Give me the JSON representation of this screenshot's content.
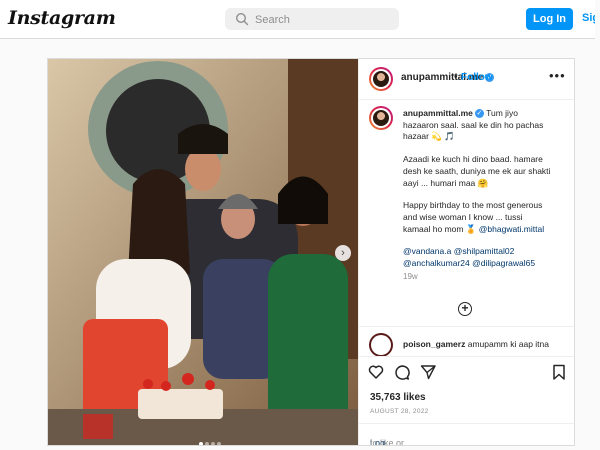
{
  "nav": {
    "logo": "Instagram",
    "search_placeholder": "Search",
    "login_label": "Log In",
    "signup_label": "Sign Up"
  },
  "post": {
    "username": "anupammittal.me",
    "follow_separator": "•",
    "follow_label": "Follow",
    "more_label": "•••",
    "caption": {
      "paragraph1": "Tum jiyo\nhazaaron saal. saal ke din ho pachas\nhazaar 💫 🎵",
      "paragraph2": "Azaadi ke kuch hi dino baad. hamare\ndesh ke saath, duniya me ek aur shakti\naayi ... humari maa 🤗",
      "paragraph3_text": "Happy birthday to the most generous\nand wise woman I know ... tussi\nkamaal ho mom 🏅 ",
      "paragraph3_mention": "@bhagwati.mittal",
      "mentions": [
        "@vandana.a",
        "@shilpamittal02",
        "@anchalkumar24",
        "@dilipagrawal65"
      ],
      "time_ago": "19w"
    },
    "add_icon": "plus-circle-icon",
    "comment": {
      "username": "poison_gamerz",
      "text": "amupamm ki aap itna"
    },
    "likes": "35,763 likes",
    "date": "AUGUST 28, 2022",
    "login_link": "Log in",
    "login_suffix": " to like or comment."
  },
  "colors": {
    "accent": "#0095f6",
    "border": "#dbdbdb",
    "text": "#262626",
    "muted": "#8e8e8e"
  }
}
